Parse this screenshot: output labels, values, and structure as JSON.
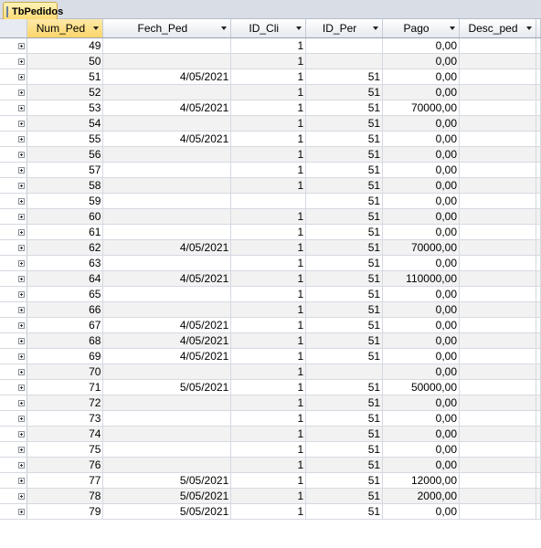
{
  "tab": {
    "label": "TbPedidos",
    "icon": "table-icon"
  },
  "columns": [
    "Num_Ped",
    "Fech_Ped",
    "ID_Cli",
    "ID_Per",
    "Pago",
    "Desc_ped"
  ],
  "rows": [
    [
      "49",
      "",
      "1",
      "",
      "0,00",
      ""
    ],
    [
      "50",
      "",
      "1",
      "",
      "0,00",
      ""
    ],
    [
      "51",
      "4/05/2021",
      "1",
      "51",
      "0,00",
      ""
    ],
    [
      "52",
      "",
      "1",
      "51",
      "0,00",
      ""
    ],
    [
      "53",
      "4/05/2021",
      "1",
      "51",
      "70000,00",
      ""
    ],
    [
      "54",
      "",
      "1",
      "51",
      "0,00",
      ""
    ],
    [
      "55",
      "4/05/2021",
      "1",
      "51",
      "0,00",
      ""
    ],
    [
      "56",
      "",
      "1",
      "51",
      "0,00",
      ""
    ],
    [
      "57",
      "",
      "1",
      "51",
      "0,00",
      ""
    ],
    [
      "58",
      "",
      "1",
      "51",
      "0,00",
      ""
    ],
    [
      "59",
      "",
      "",
      "51",
      "0,00",
      ""
    ],
    [
      "60",
      "",
      "1",
      "51",
      "0,00",
      ""
    ],
    [
      "61",
      "",
      "1",
      "51",
      "0,00",
      ""
    ],
    [
      "62",
      "4/05/2021",
      "1",
      "51",
      "70000,00",
      ""
    ],
    [
      "63",
      "",
      "1",
      "51",
      "0,00",
      ""
    ],
    [
      "64",
      "4/05/2021",
      "1",
      "51",
      "110000,00",
      ""
    ],
    [
      "65",
      "",
      "1",
      "51",
      "0,00",
      ""
    ],
    [
      "66",
      "",
      "1",
      "51",
      "0,00",
      ""
    ],
    [
      "67",
      "4/05/2021",
      "1",
      "51",
      "0,00",
      ""
    ],
    [
      "68",
      "4/05/2021",
      "1",
      "51",
      "0,00",
      ""
    ],
    [
      "69",
      "4/05/2021",
      "1",
      "51",
      "0,00",
      ""
    ],
    [
      "70",
      "",
      "1",
      "",
      "0,00",
      ""
    ],
    [
      "71",
      "5/05/2021",
      "1",
      "51",
      "50000,00",
      ""
    ],
    [
      "72",
      "",
      "1",
      "51",
      "0,00",
      ""
    ],
    [
      "73",
      "",
      "1",
      "51",
      "0,00",
      ""
    ],
    [
      "74",
      "",
      "1",
      "51",
      "0,00",
      ""
    ],
    [
      "75",
      "",
      "1",
      "51",
      "0,00",
      ""
    ],
    [
      "76",
      "",
      "1",
      "51",
      "0,00",
      ""
    ],
    [
      "77",
      "5/05/2021",
      "1",
      "51",
      "12000,00",
      ""
    ],
    [
      "78",
      "5/05/2021",
      "1",
      "51",
      "2000,00",
      ""
    ],
    [
      "79",
      "5/05/2021",
      "1",
      "51",
      "0,00",
      ""
    ]
  ]
}
